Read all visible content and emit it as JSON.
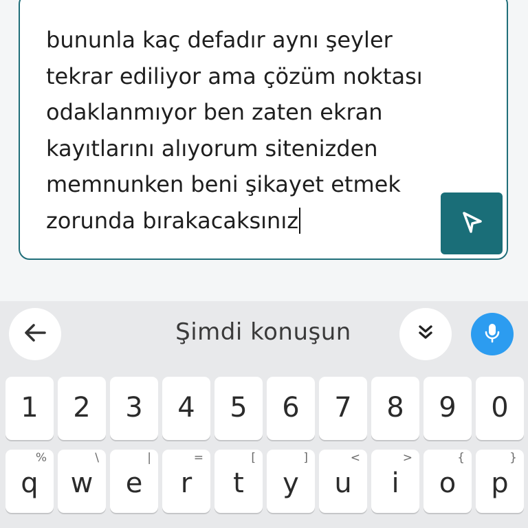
{
  "composer": {
    "message_lines": [
      "bununla kaç defadır aynı şeyler",
      "tekrar ediliyor ama çözüm noktası",
      "odaklanmıyor ben zaten ekran",
      "kayıtlarını alıyorum sitenizden",
      "memnunken beni şikayet etmek",
      "zorunda bırakacaksınız"
    ],
    "send_icon": "send-arrow-icon",
    "accent_color": "#1a6e78"
  },
  "keyboard": {
    "voice_prompt": "Şimdi konuşun",
    "mic_color": "#2c9cf0",
    "toolbar_icons": [
      "back-arrow-icon",
      "collapse-chevrons-icon",
      "microphone-icon"
    ],
    "number_row": [
      "1",
      "2",
      "3",
      "4",
      "5",
      "6",
      "7",
      "8",
      "9",
      "0"
    ],
    "letter_row": [
      {
        "key": "q",
        "hint": "%"
      },
      {
        "key": "w",
        "hint": "\\"
      },
      {
        "key": "e",
        "hint": "|"
      },
      {
        "key": "r",
        "hint": "="
      },
      {
        "key": "t",
        "hint": "["
      },
      {
        "key": "y",
        "hint": "]"
      },
      {
        "key": "u",
        "hint": "<"
      },
      {
        "key": "i",
        "hint": ">"
      },
      {
        "key": "o",
        "hint": "{"
      },
      {
        "key": "p",
        "hint": "}"
      }
    ]
  }
}
